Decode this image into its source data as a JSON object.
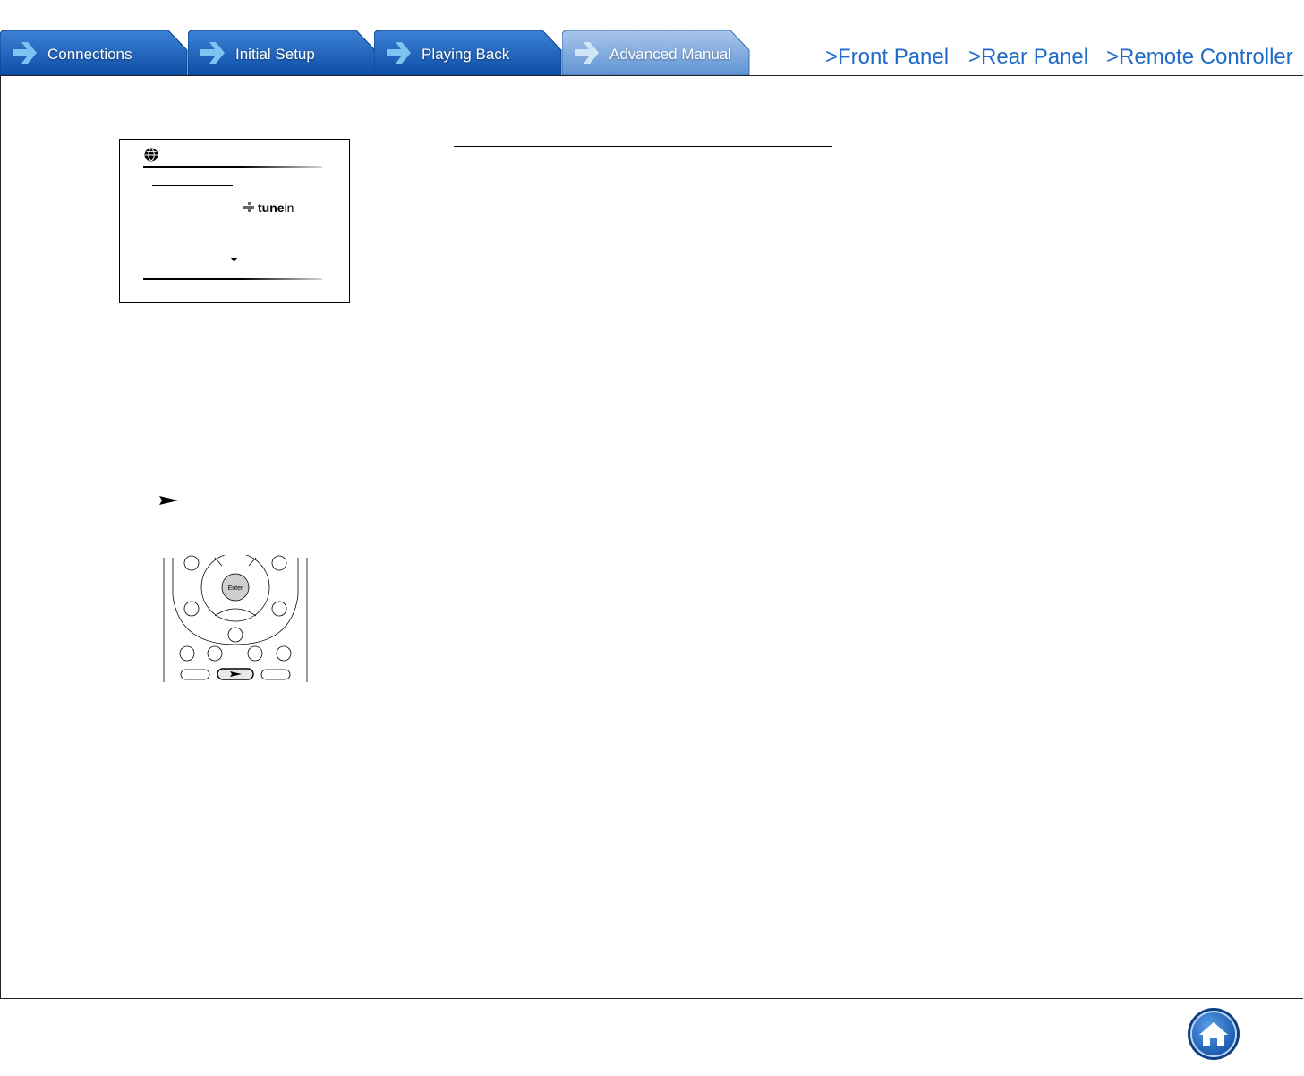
{
  "tabs": [
    {
      "label": "Connections",
      "active": false
    },
    {
      "label": "Initial Setup",
      "active": false
    },
    {
      "label": "Playing Back",
      "active": false
    },
    {
      "label": "Advanced Manual",
      "active": true
    }
  ],
  "links": {
    "front_panel": ">Front Panel",
    "rear_panel": ">Rear Panel",
    "remote_controller": ">Remote Controller"
  },
  "screen": {
    "logo_bold": "tune",
    "logo_rest": "in",
    "icon": "globe-icon"
  },
  "remote": {
    "enter_label": "Enter",
    "play_icon": "play-icon"
  },
  "colors": {
    "tab_blue": "#1a5fb4",
    "tab_active": "#7fa8d8",
    "link_blue": "#1f6bc9",
    "home_blue": "#1d5bb5"
  },
  "home_icon": "home-icon"
}
